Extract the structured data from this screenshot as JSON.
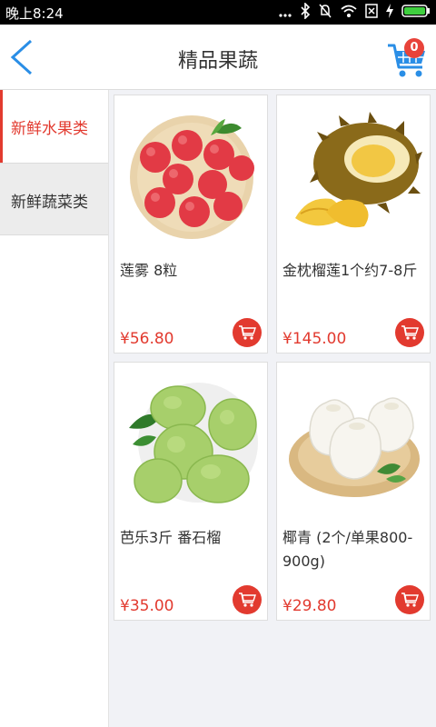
{
  "status_bar": {
    "time": "晚上8:24"
  },
  "header": {
    "title": "精品果蔬",
    "cart_count": "0"
  },
  "categories": [
    {
      "label": "新鲜水果类",
      "active": true
    },
    {
      "label": "新鲜蔬菜类",
      "active": false
    }
  ],
  "products": [
    {
      "name": "莲雾 8粒",
      "price": "¥56.80",
      "image": "wax-apple-image"
    },
    {
      "name": "金枕榴莲1个约7-8斤",
      "price": "¥145.00",
      "image": "durian-image"
    },
    {
      "name": "芭乐3斤 番石榴",
      "price": "¥35.00",
      "image": "guava-image"
    },
    {
      "name": "椰青 (2个/单果800-900g)",
      "price": "¥29.80",
      "image": "coconut-image"
    }
  ],
  "colors": {
    "accent": "#e23a2f",
    "header_icon": "#2a8ee6",
    "background": "#f1f2f6"
  }
}
